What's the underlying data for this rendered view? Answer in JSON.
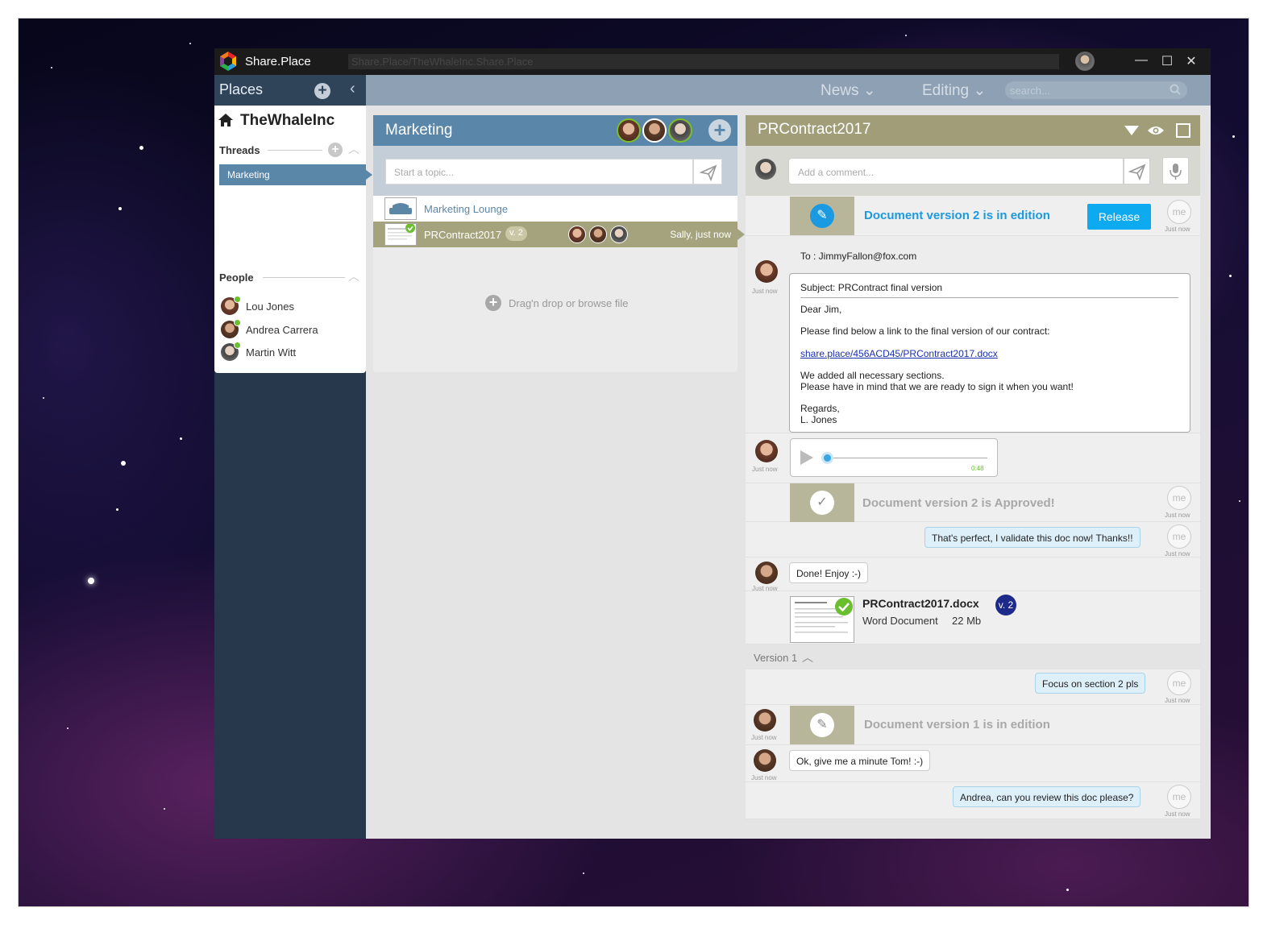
{
  "titlebar": {
    "app_name": "Share.Place",
    "url": "Share.Place/TheWhaleInc.Share.Place",
    "minimize": "—",
    "maximize": "☐",
    "close": "✕"
  },
  "sidebar": {
    "places_title": "Places",
    "add_symbol": "+",
    "collapse_symbol": "‹",
    "org_name": "TheWhaleInc",
    "threads_title": "Threads",
    "threads": [
      {
        "label": "Marketing"
      }
    ],
    "people_title": "People",
    "people": [
      {
        "name": "Lou Jones"
      },
      {
        "name": "Andrea Carrera"
      },
      {
        "name": "Martin Witt"
      }
    ]
  },
  "topnav": {
    "news_label": "News",
    "editing_label": "Editing",
    "search_placeholder": "search..."
  },
  "thread_panel": {
    "title": "Marketing",
    "topic_placeholder": "Start a topic...",
    "items": [
      {
        "label": "Marketing Lounge"
      },
      {
        "label": "PRContract2017",
        "version": "v. 2",
        "meta": "Sally, just now"
      }
    ],
    "drop_text": "Drag'n drop or browse file"
  },
  "document_panel": {
    "title": "PRContract2017",
    "comment_placeholder": "Add a comment...",
    "me_label": "me",
    "just_now": "Just now",
    "edition_event": "Document version 2 is in edition",
    "release_label": "Release",
    "email": {
      "to": "To : JimmyFallon@fox.com",
      "subject": "Subject: PRContract final version",
      "greeting": "Dear Jim,",
      "line1": "Please find below a link to the final version of our contract:",
      "link": "share.place/456ACD45/PRContract2017.docx",
      "line2": "We added all necessary sections.",
      "line3": "Please have in mind that we are ready to sign it when you want!",
      "regards": "Regards,",
      "signature": "L. Jones"
    },
    "audio_duration": "0:48",
    "approved_event": "Document version 2 is Approved!",
    "msg_validate": "That's perfect, I validate this doc now! Thanks!!",
    "msg_done": "Done! Enjoy :-)",
    "file": {
      "name": "PRContract2017.docx",
      "version": "v. 2",
      "type": "Word Document",
      "size": "22 Mb"
    },
    "version_divider": "Version 1",
    "msg_focus": "Focus on section 2 pls",
    "edition_v1_event": "Document version 1 is in edition",
    "msg_minute": "Ok, give me a minute Tom!  :-)",
    "msg_review": "Andrea, can you review this doc please?"
  },
  "colors": {
    "sidebar_bg": "#27374c",
    "thread_header": "#5a87a9",
    "doc_header": "#a09d78",
    "accent_blue": "#0eaaf0",
    "online_green": "#6abf2e",
    "version_badge": "#1e2a8a"
  }
}
